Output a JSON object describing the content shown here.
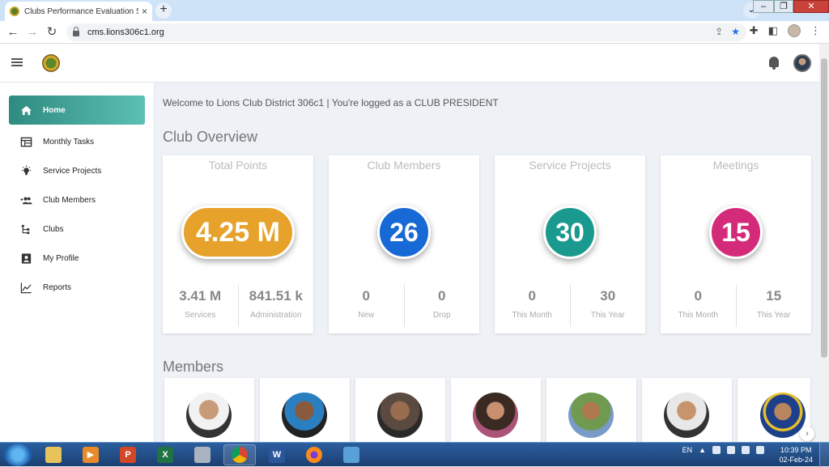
{
  "browser": {
    "tab_title": "Clubs Performance Evaluation Sy",
    "tab_close": "×",
    "new_tab": "+",
    "url": "cms.lions306c1.org"
  },
  "header": {},
  "sidebar": {
    "items": [
      {
        "label": "Home",
        "icon": "home-icon"
      },
      {
        "label": "Monthly Tasks",
        "icon": "calendar-table-icon"
      },
      {
        "label": "Service Projects",
        "icon": "lightbulb-icon"
      },
      {
        "label": "Club Members",
        "icon": "group-add-icon"
      },
      {
        "label": "Clubs",
        "icon": "tree-icon"
      },
      {
        "label": "My Profile",
        "icon": "profile-card-icon"
      },
      {
        "label": "Reports",
        "icon": "line-chart-icon"
      }
    ]
  },
  "main": {
    "welcome": "Welcome to Lions Club District 306c1 | You're logged as a CLUB PRESIDENT",
    "overview_title": "Club Overview",
    "members_title": "Members",
    "cards": [
      {
        "title": "Total Points",
        "value": "4.25 M",
        "color": "#e6a22a",
        "stats": [
          {
            "value": "3.41 M",
            "label": "Services"
          },
          {
            "value": "841.51 k",
            "label": "Administration"
          }
        ]
      },
      {
        "title": "Club Members",
        "value": "26",
        "color": "#1769d6",
        "stats": [
          {
            "value": "0",
            "label": "New"
          },
          {
            "value": "0",
            "label": "Drop"
          }
        ]
      },
      {
        "title": "Service Projects",
        "value": "30",
        "color": "#1a9a8e",
        "stats": [
          {
            "value": "0",
            "label": "This Month"
          },
          {
            "value": "30",
            "label": "This Year"
          }
        ]
      },
      {
        "title": "Meetings",
        "value": "15",
        "color": "#d42a7a",
        "stats": [
          {
            "value": "0",
            "label": "This Month"
          },
          {
            "value": "15",
            "label": "This Year"
          }
        ]
      }
    ]
  },
  "taskbar": {
    "lang": "EN",
    "time": "10:39 PM",
    "date": "02-Feb-24",
    "ppt": "P",
    "excel": "X",
    "word": "W"
  }
}
